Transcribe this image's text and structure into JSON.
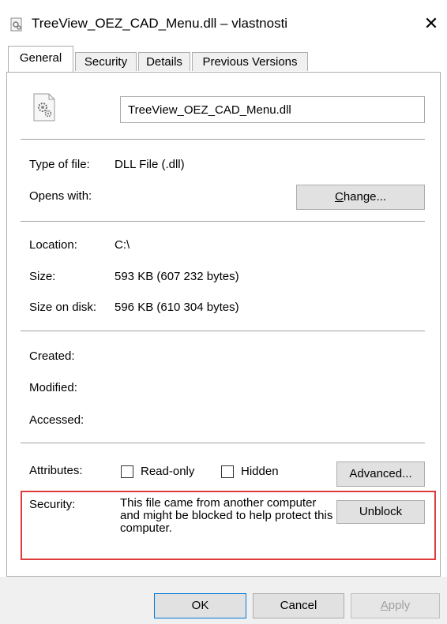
{
  "window": {
    "title": "TreeView_OEZ_CAD_Menu.dll – vlastnosti",
    "close_glyph": "✕"
  },
  "tabs": [
    {
      "label": "General",
      "active": true
    },
    {
      "label": "Security",
      "active": false
    },
    {
      "label": "Details",
      "active": false
    },
    {
      "label": "Previous Versions",
      "active": false
    }
  ],
  "file": {
    "name": "TreeView_OEZ_CAD_Menu.dll",
    "icon": "dll-file-icon"
  },
  "fields": {
    "type_label": "Type of file:",
    "type_value": "DLL File (.dll)",
    "opens_label": "Opens with:",
    "change_button_pre": "",
    "change_button_accel": "C",
    "change_button_post": "hange...",
    "location_label": "Location:",
    "location_value": "C:\\",
    "size_label": "Size:",
    "size_value": "593 KB (607 232 bytes)",
    "size_disk_label": "Size on disk:",
    "size_disk_value": "596 KB (610 304 bytes)",
    "created_label": "Created:",
    "modified_label": "Modified:",
    "accessed_label": "Accessed:"
  },
  "attributes": {
    "label": "Attributes:",
    "readonly_label": "Read-only",
    "readonly_checked": false,
    "hidden_label": "Hidden",
    "hidden_checked": false,
    "advanced_label": "Advanced..."
  },
  "security": {
    "label": "Security:",
    "message": "This file came from another computer and might be blocked to help protect this computer.",
    "unblock_label": "Unblock",
    "highlight_color": "#e03c3c"
  },
  "footer": {
    "ok_label": "OK",
    "cancel_label": "Cancel",
    "apply_accel": "A",
    "apply_rest": "pply"
  }
}
